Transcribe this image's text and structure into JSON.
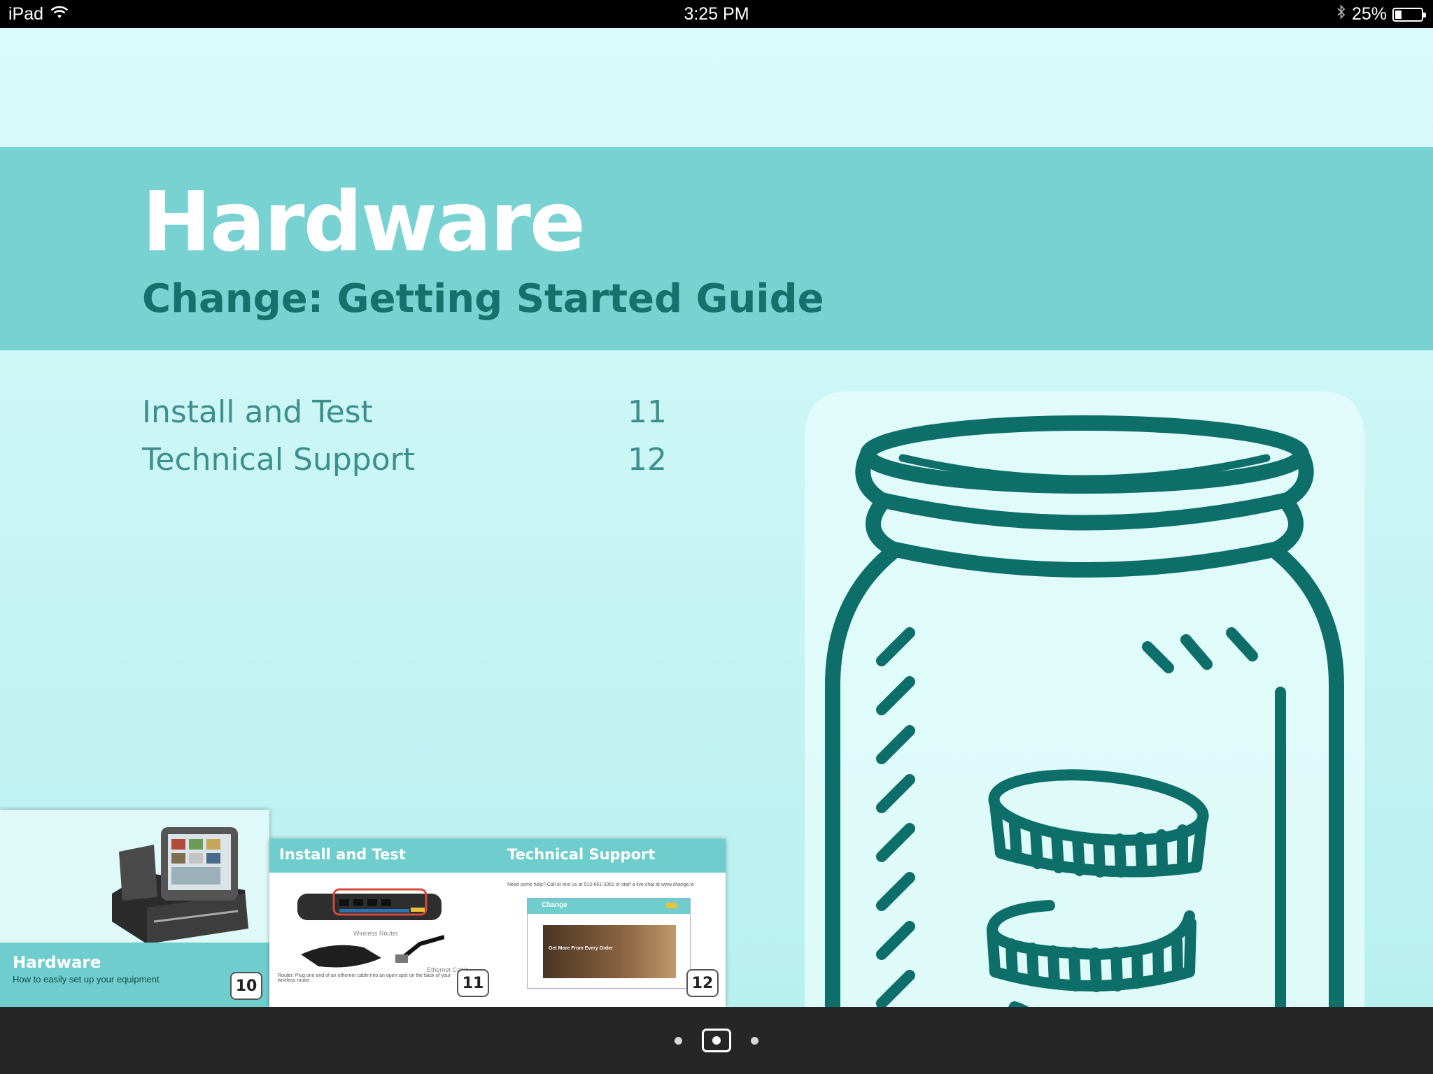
{
  "status_bar": {
    "device": "iPad",
    "time": "3:25 PM",
    "battery": "25%",
    "battery_level": 0.25,
    "icons": [
      "wifi-icon",
      "bluetooth-icon",
      "battery-icon"
    ]
  },
  "header": {
    "title": "Hardware",
    "subtitle": "Change: Getting Started Guide"
  },
  "toc": [
    {
      "label": "Install and Test",
      "page": "11"
    },
    {
      "label": "Technical Support",
      "page": "12"
    }
  ],
  "thumbnails": {
    "hardware": {
      "title": "Hardware",
      "subtitle": "How to easily set up your equipment",
      "page": "10"
    },
    "install": {
      "title": "Install and Test",
      "page": "11",
      "router_caption": "Wireless Router",
      "cable_caption": "Ethernet Cable",
      "router_note": "Router: Plug one end of an ethernet cable into an open spot on the back of your wireless router."
    },
    "support": {
      "title": "Technical Support",
      "page": "12",
      "help_text": "Need some help? Call or text us at 513-661-3361 or start a live chat at www.change.io",
      "site_brand": "Change",
      "hero_text": "Get More From Every Order"
    }
  },
  "pager": {
    "total_dots": 3,
    "current_index": 1
  },
  "colors": {
    "banner": "#79d2d2",
    "teal_dark": "#0e6f6a",
    "background": "#d6f8f7",
    "toolbar": "#262627"
  }
}
